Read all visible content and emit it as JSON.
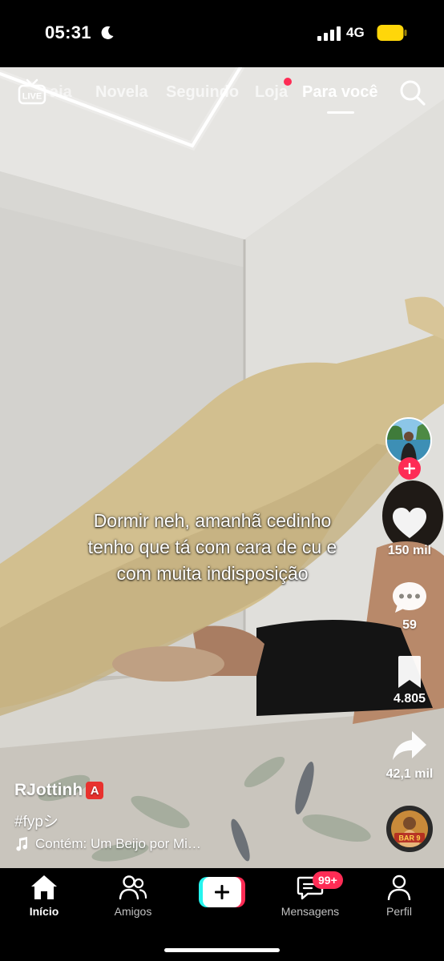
{
  "status_bar": {
    "time": "05:31",
    "network": "4G",
    "icons": [
      "moon-icon",
      "signal-icon",
      "battery-icon"
    ]
  },
  "top_nav": {
    "live_label": "LIVE",
    "tabs": [
      {
        "label": "Paraíba",
        "visible_fragment": "aia"
      },
      {
        "label": "Novela"
      },
      {
        "label": "Seguindo"
      },
      {
        "label": "Loja"
      },
      {
        "label": "Para você",
        "active": true
      }
    ]
  },
  "video": {
    "caption_lines": [
      "Dormir neh, amanhã cedinho",
      "tenho que tá com cara de cu e",
      "com muita indisposição"
    ],
    "username": "RJottinh",
    "username_badge": "A",
    "hashtag": "#fypシ",
    "music": "Contém: Um Beijo por Mi…",
    "music_disc_label": "BAR 9"
  },
  "actions": {
    "likes": "150 mil",
    "comments": "59",
    "bookmarks": "4.805",
    "shares": "42,1 mil"
  },
  "bottom_nav": {
    "items": [
      {
        "label": "Início",
        "icon": "home-icon",
        "active": true
      },
      {
        "label": "Amigos",
        "icon": "friends-icon"
      },
      {
        "label": "Mensagens",
        "icon": "messages-icon",
        "badge": "99+"
      },
      {
        "label": "Perfil",
        "icon": "profile-icon"
      }
    ]
  },
  "colors": {
    "accent": "#fe2c55",
    "cyan": "#25f4ee",
    "battery": "#ffd60a",
    "badge_red": "#e8322e"
  }
}
